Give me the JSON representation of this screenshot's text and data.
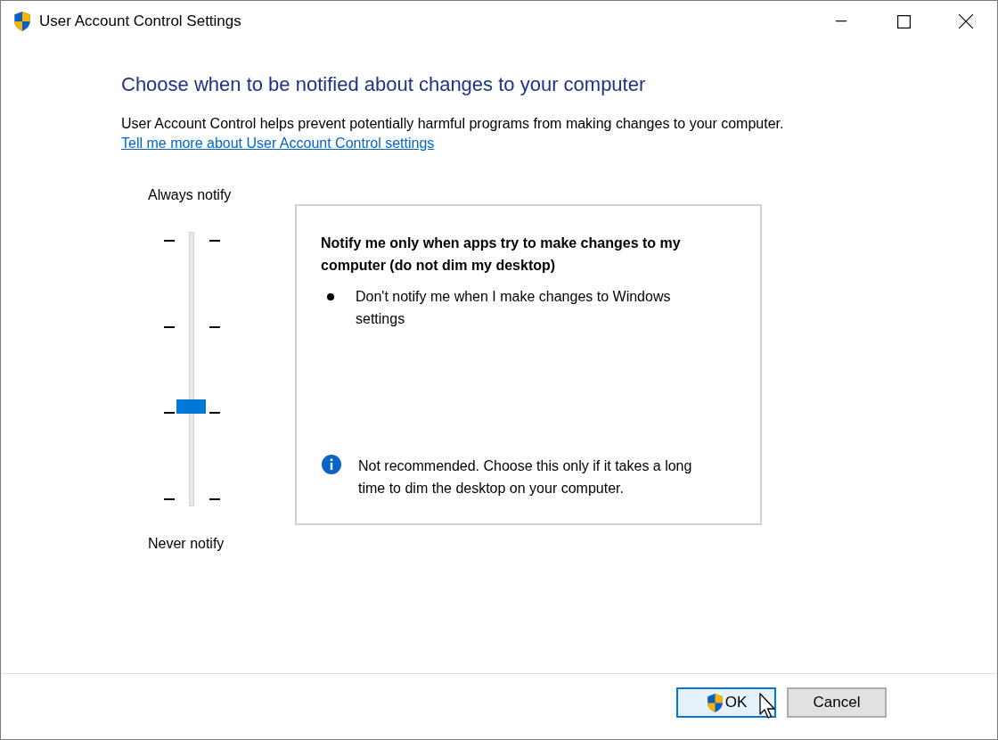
{
  "window": {
    "title": "User Account Control Settings"
  },
  "heading": "Choose when to be notified about changes to your computer",
  "description": "User Account Control helps prevent potentially harmful programs from making changes to your computer.",
  "link": "Tell me more about User Account Control settings",
  "slider": {
    "top_label": "Always notify",
    "bottom_label": "Never notify",
    "level": 0.333
  },
  "detail": {
    "title": "Notify me only when apps try to make changes to my computer (do not dim my desktop)",
    "bullets": [
      "Don't notify me when I make changes to Windows settings"
    ],
    "note": "Not recommended. Choose this only if it takes a long time to dim the desktop on your computer."
  },
  "buttons": [
    {
      "label": "OK",
      "shield": true,
      "highlighted": true
    },
    {
      "label": "Cancel",
      "shield": false,
      "highlighted": false
    }
  ]
}
